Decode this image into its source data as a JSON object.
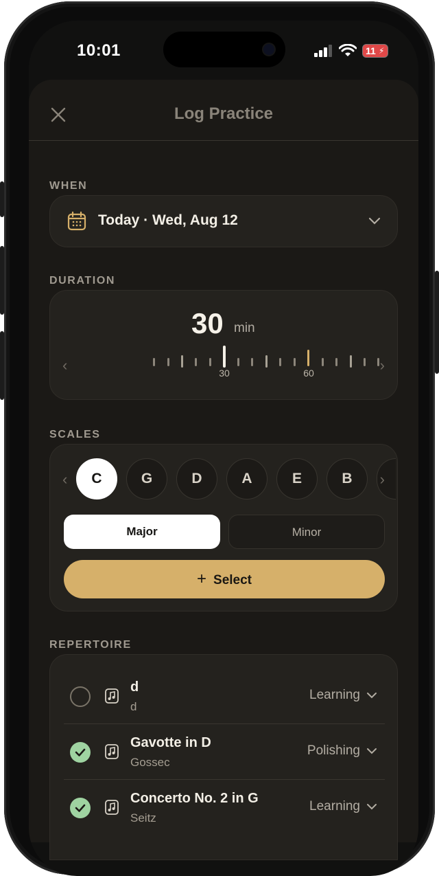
{
  "status_bar": {
    "time": "10:01",
    "battery": "11"
  },
  "header": {
    "title": "Log Practice"
  },
  "when": {
    "label": "WHEN",
    "value": "Today · Wed, Aug 12"
  },
  "duration": {
    "label": "DURATION",
    "value": "30",
    "unit": "min",
    "tick_labels": [
      "30",
      "60"
    ]
  },
  "scales": {
    "label": "SCALES",
    "keys": [
      "C",
      "G",
      "D",
      "A",
      "E",
      "B"
    ],
    "selected_key": "C",
    "modes": [
      "Major",
      "Minor"
    ],
    "selected_mode": "Major",
    "select_label": "Select"
  },
  "repertoire": {
    "label": "REPERTOIRE",
    "items": [
      {
        "title": "d",
        "composer": "d",
        "stage": "Learning",
        "done": false
      },
      {
        "title": "Gavotte in D",
        "composer": "Gossec",
        "stage": "Polishing",
        "done": true
      },
      {
        "title": "Concerto No. 2 in G",
        "composer": "Seitz",
        "stage": "Learning",
        "done": true
      }
    ]
  },
  "colors": {
    "accent": "#d6b06a",
    "done_green": "#9fd3a1",
    "background": "#1b1916"
  }
}
